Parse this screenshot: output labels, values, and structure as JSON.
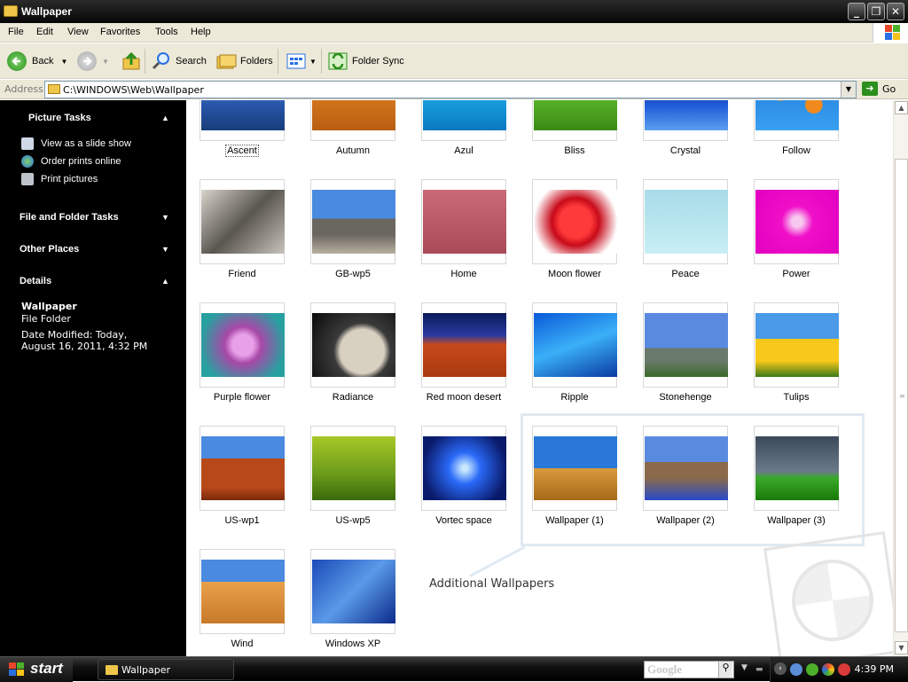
{
  "window": {
    "title": "Wallpaper"
  },
  "menu": [
    "File",
    "Edit",
    "View",
    "Favorites",
    "Tools",
    "Help"
  ],
  "toolbar": {
    "back": "Back",
    "search": "Search",
    "folders": "Folders",
    "folder_sync": "Folder Sync"
  },
  "address": {
    "label": "Address",
    "path": "C:\\WINDOWS\\Web\\Wallpaper",
    "go": "Go"
  },
  "left_pane": {
    "picture_tasks": {
      "title": "Picture Tasks",
      "items": [
        "View as a slide show",
        "Order prints online",
        "Print pictures"
      ]
    },
    "file_folder_tasks": "File and Folder Tasks",
    "other_places": "Other Places",
    "details": {
      "title": "Details",
      "name": "Wallpaper",
      "type": "File Folder",
      "modified": "Date Modified: Today, August 16, 2011, 4:32 PM"
    }
  },
  "files": [
    "Ascent",
    "Autumn",
    "Azul",
    "Bliss",
    "Crystal",
    "Follow",
    "Friend",
    "GB-wp5",
    "Home",
    "Moon flower",
    "Peace",
    "Power",
    "Purple flower",
    "Radiance",
    "Red moon desert",
    "Ripple",
    "Stonehenge",
    "Tulips",
    "US-wp1",
    "US-wp5",
    "Vortec space",
    "Wallpaper (1)",
    "Wallpaper (2)",
    "Wallpaper (3)",
    "Wind",
    "Windows XP"
  ],
  "annotation": "Additional Wallpapers",
  "taskbar": {
    "start": "start",
    "task": "Wallpaper",
    "search": "Google",
    "clock": "4:39 PM"
  }
}
